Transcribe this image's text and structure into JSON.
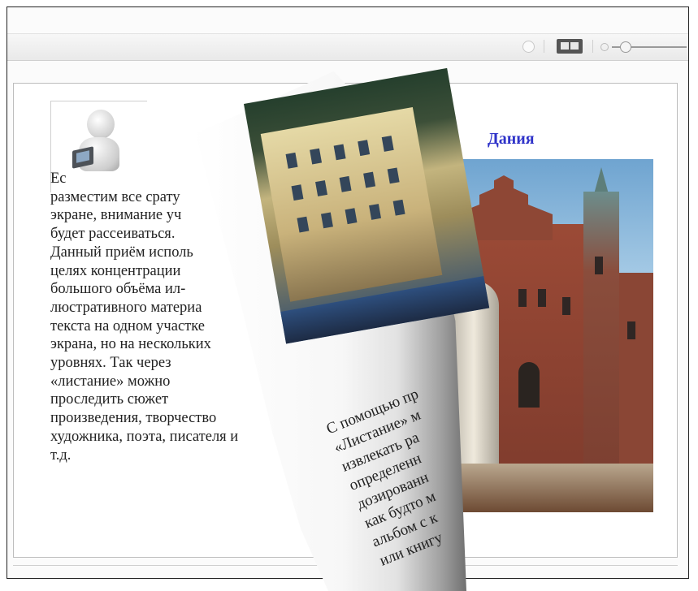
{
  "toolbar": {
    "items": [
      "circle-toggle-icon",
      "two-page-view-icon",
      "zoom-small-icon",
      "zoom-slider"
    ],
    "zoom_level": 0.15
  },
  "left_panel": {
    "paragraph": "Ес\nразместим все срату\nэкране, внимание уч\nбудет рассеиваться.\nДанный приём исполь\nцелях концентрации\nбольшого объёма ил-\nлюстративного материа\nтекста на одном участке\nэкрана, но на нескольких\nуровнях. Так через\n«листание» можно\nпроследить сюжет\nпроизведения, творчество\nхудожника, поэта, писателя и\nт.д."
  },
  "right_panel": {
    "title": "Дания"
  },
  "curl_page": {
    "text": "С помощью пр\n«Листание» м\nизвлекать ра\nопределенн\nдозированн\nкак будто м\nальбом с к\nили книгу"
  },
  "colors": {
    "title": "#2f33c9",
    "frame_border": "#222222",
    "page_border": "#bdbdbd"
  }
}
